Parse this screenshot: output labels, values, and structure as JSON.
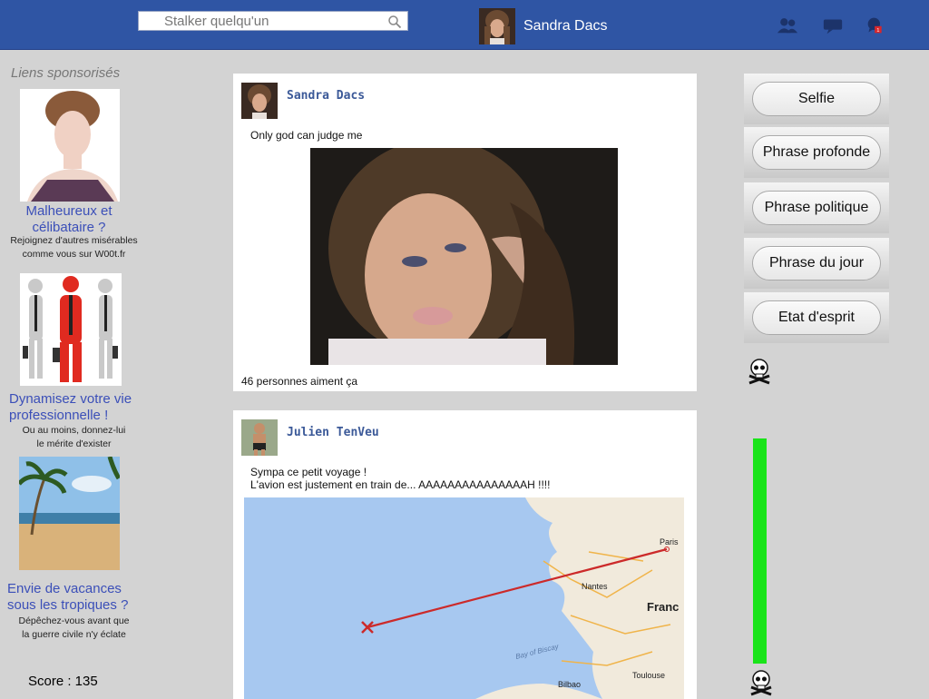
{
  "header": {
    "search_placeholder": "Stalker quelqu'un",
    "user_name": "Sandra Dacs",
    "notification_count": "1"
  },
  "sidebar": {
    "title": "Liens sponsorisés",
    "ads": [
      {
        "title": "Malheureux et célibataire ?",
        "desc_line1": "Rejoignez d'autres misérables",
        "desc_line2": "comme vous sur W00t.fr"
      },
      {
        "title": "Dynamisez votre vie professionnelle !",
        "desc_line1": "Ou au moins, donnez-lui",
        "desc_line2": "le mérite d'exister"
      },
      {
        "title": "Envie de vacances sous les tropiques ?",
        "desc_line1": "Dépêchez-vous avant que",
        "desc_line2": "la guerre civile n'y éclate"
      }
    ],
    "score_label": "Score : 135"
  },
  "posts": [
    {
      "author": "Sandra Dacs",
      "text": "Only god can judge me",
      "likes": "46 personnes aiment ça"
    },
    {
      "author": "Julien TenVeu",
      "text_line1": "Sympa ce petit voyage !",
      "text_line2": "L'avion est justement en train de...  AAAAAAAAAAAAAAAH !!!!",
      "map_labels": {
        "paris": "Paris",
        "nantes": "Nantes",
        "france": "Franc",
        "bay": "Bay of Biscay",
        "toulouse": "Toulouse",
        "bilbao": "Bilbao"
      }
    }
  ],
  "actions": [
    "Selfie",
    "Phrase profonde",
    "Phrase politique",
    "Phrase du jour",
    "Etat d'esprit"
  ],
  "meter": {
    "level": 1.0,
    "color": "#19e419"
  },
  "colors": {
    "topbar": "#2f55a4",
    "link": "#3b4fb8",
    "author": "#3b5998"
  }
}
